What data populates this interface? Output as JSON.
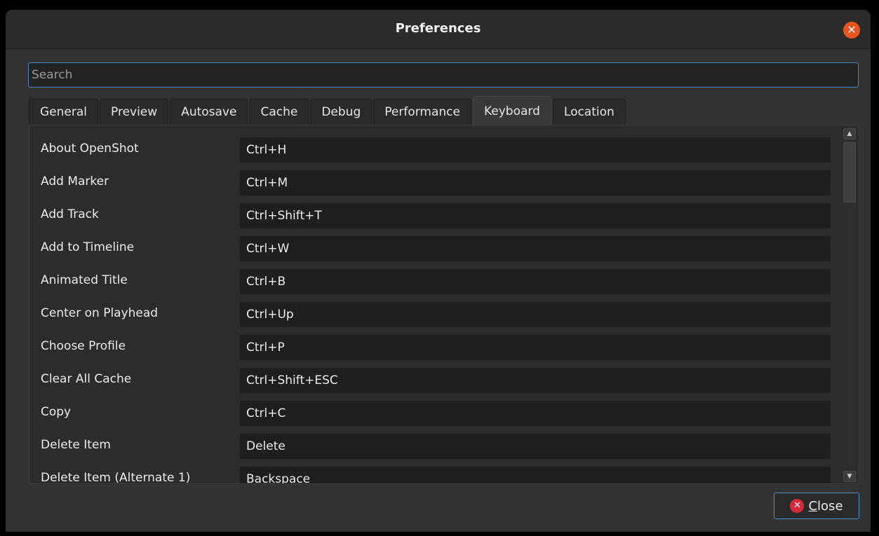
{
  "window": {
    "title": "Preferences",
    "close_icon": "close-icon",
    "accent_color": "#e95420"
  },
  "search": {
    "placeholder": "Search",
    "value": ""
  },
  "tabs": [
    {
      "label": "General",
      "active": false
    },
    {
      "label": "Preview",
      "active": false
    },
    {
      "label": "Autosave",
      "active": false
    },
    {
      "label": "Cache",
      "active": false
    },
    {
      "label": "Debug",
      "active": false
    },
    {
      "label": "Performance",
      "active": false
    },
    {
      "label": "Keyboard",
      "active": true
    },
    {
      "label": "Location",
      "active": false
    }
  ],
  "shortcuts": [
    {
      "label": "About OpenShot",
      "value": "Ctrl+H"
    },
    {
      "label": "Add Marker",
      "value": "Ctrl+M"
    },
    {
      "label": "Add Track",
      "value": "Ctrl+Shift+T"
    },
    {
      "label": "Add to Timeline",
      "value": "Ctrl+W"
    },
    {
      "label": "Animated Title",
      "value": "Ctrl+B"
    },
    {
      "label": "Center on Playhead",
      "value": "Ctrl+Up"
    },
    {
      "label": "Choose Profile",
      "value": "Ctrl+P"
    },
    {
      "label": "Clear All Cache",
      "value": "Ctrl+Shift+ESC"
    },
    {
      "label": "Copy",
      "value": "Ctrl+C"
    },
    {
      "label": "Delete Item",
      "value": "Delete"
    },
    {
      "label": "Delete Item (Alternate 1)",
      "value": "Backspace"
    }
  ],
  "footer": {
    "close_mnemonic": "C",
    "close_rest": "lose",
    "close_icon": "close-circle-icon",
    "close_icon_color": "#d42a3b"
  }
}
